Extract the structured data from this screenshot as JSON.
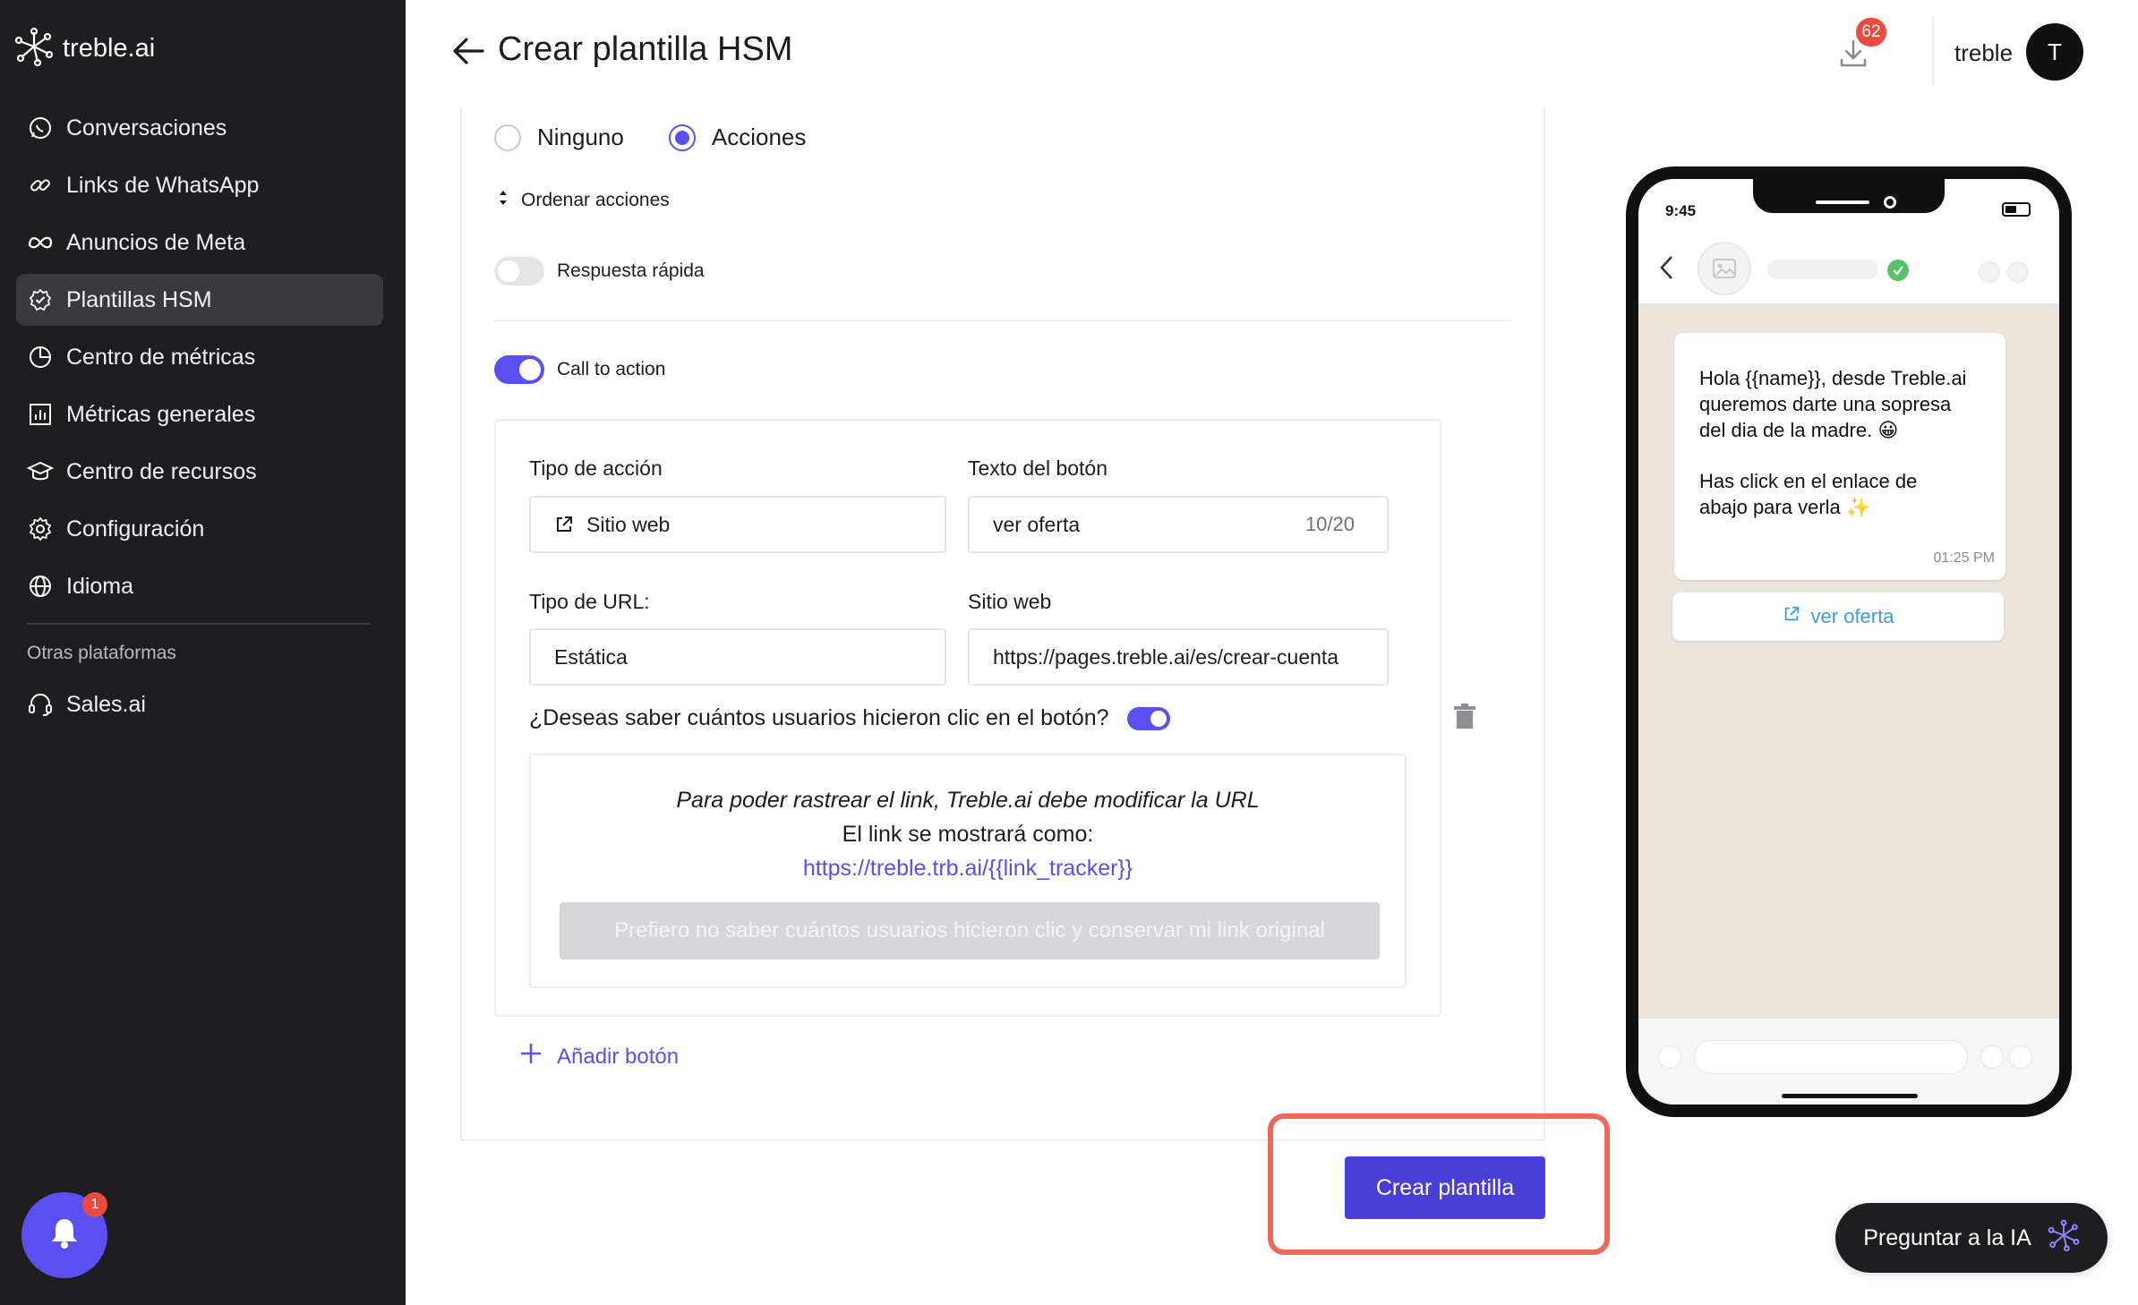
{
  "sidebar": {
    "brand": "treble.ai",
    "items": [
      {
        "label": "Conversaciones",
        "icon": "whatsapp-icon"
      },
      {
        "label": "Links de WhatsApp",
        "icon": "link-icon"
      },
      {
        "label": "Anuncios de Meta",
        "icon": "meta-icon"
      },
      {
        "label": "Plantillas HSM",
        "icon": "badge-check-icon",
        "active": true
      },
      {
        "label": "Centro de métricas",
        "icon": "pie-chart-icon"
      },
      {
        "label": "Métricas generales",
        "icon": "bar-chart-icon"
      },
      {
        "label": "Centro de recursos",
        "icon": "graduation-cap-icon"
      },
      {
        "label": "Configuración",
        "icon": "gear-icon"
      },
      {
        "label": "Idioma",
        "icon": "globe-icon"
      }
    ],
    "other_title": "Otras plataformas",
    "other_items": [
      {
        "label": "Sales.ai",
        "icon": "headset-icon"
      }
    ],
    "notification_count": "1"
  },
  "header": {
    "title": "Crear plantilla HSM",
    "downloads_count": "62",
    "user_name": "treble",
    "avatar_initial": "T"
  },
  "form": {
    "button_type_options": [
      {
        "label": "Ninguno",
        "checked": false
      },
      {
        "label": "Acciones",
        "checked": true
      }
    ],
    "sort_label": "Ordenar acciones",
    "quick_reply": {
      "label": "Respuesta rápida",
      "enabled": false
    },
    "call_to_action": {
      "label": "Call to action",
      "enabled": true
    },
    "action": {
      "type_label": "Tipo de acción",
      "type_value": "Sitio web",
      "text_label": "Texto del botón",
      "text_value": "ver oferta",
      "text_counter": "10/20",
      "url_type_label": "Tipo de URL:",
      "url_type_value": "Estática",
      "website_label": "Sitio web",
      "website_value": "https://pages.treble.ai/es/crear-cuenta"
    },
    "tracking": {
      "question": "¿Deseas saber cuántos usuarios hicieron clic en el botón?",
      "enabled": true,
      "line1": "Para poder rastrear el link, Treble.ai debe modificar la URL",
      "line2": "El link se mostrará como:",
      "line3": "https://treble.trb.ai/{{link_tracker}}",
      "keep_button": "Prefiero no saber cuántos usuarios hicieron clic y conservar mi link original"
    },
    "add_button": "Añadir botón",
    "create_button": "Crear plantilla"
  },
  "preview": {
    "time": "9:45",
    "message_lines_1": [
      "Hola {{name}}, desde Treble.ai",
      "queremos darte una sopresa",
      "del dia de la madre. 😀"
    ],
    "message_lines_2": [
      "Has click en el enlace de",
      "abajo para verla ✨"
    ],
    "message_time": "01:25 PM",
    "button_label": "ver oferta"
  },
  "ask_ai": "Preguntar a la IA",
  "colors": {
    "accent": "#5a4ff0",
    "sidebar_bg": "#1e1e20",
    "highlight": "#ec6a5a"
  }
}
